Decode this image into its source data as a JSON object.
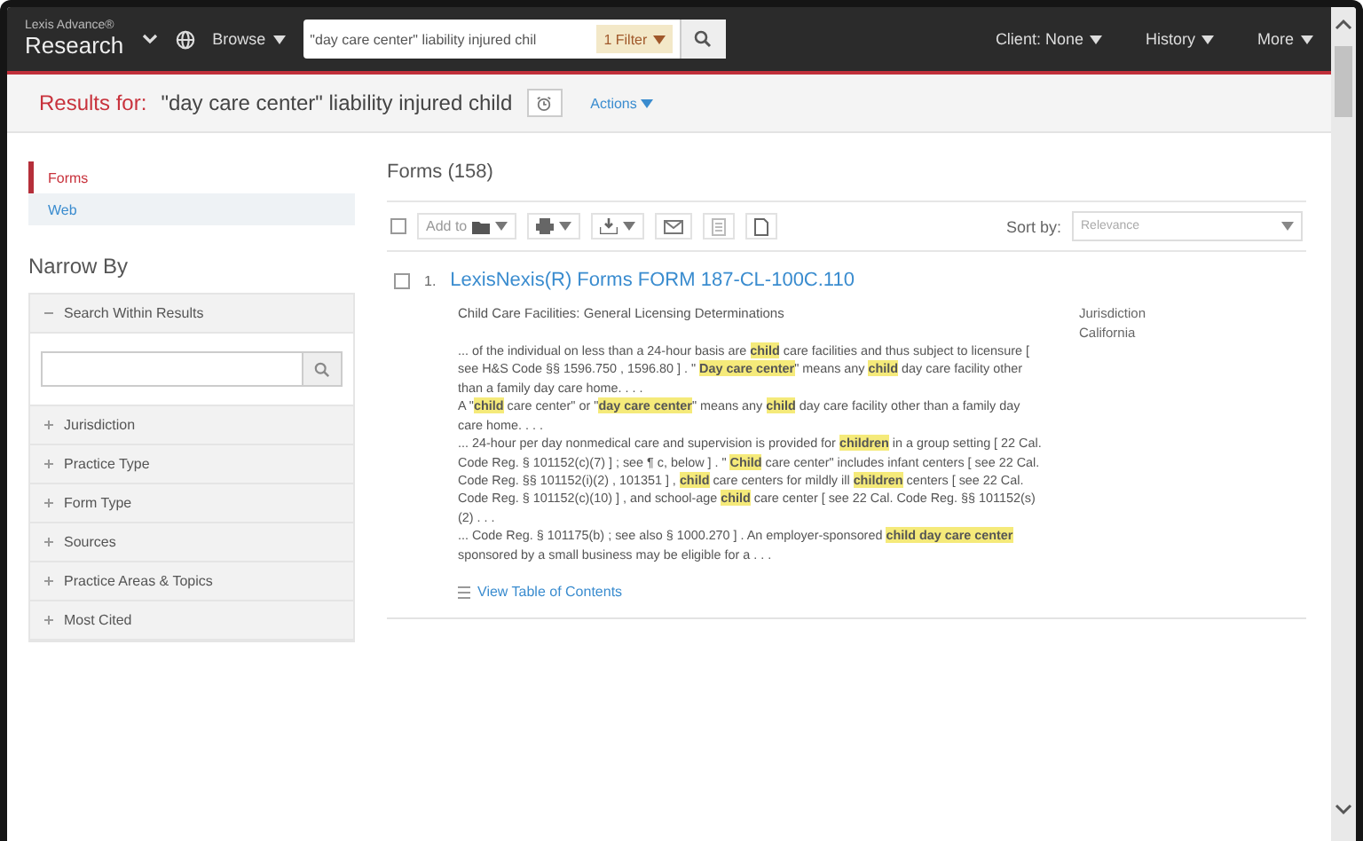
{
  "topbar": {
    "brand_small": "Lexis Advance®",
    "brand": "Research",
    "browse": "Browse",
    "search": {
      "value": "\"day care center\" liability injured chil",
      "filter": "1 Filter"
    },
    "menus": [
      "Client: None",
      "History",
      "More"
    ]
  },
  "results_bar": {
    "label": "Results for:",
    "query": "\"day care center\" liability injured child",
    "actions": "Actions"
  },
  "sidebar": {
    "tabs": [
      {
        "label": "Forms",
        "selected": true
      },
      {
        "label": "Web",
        "selected": false
      }
    ],
    "narrow_by": "Narrow By",
    "filters": [
      {
        "label": "Search Within Results",
        "expanded": true
      },
      {
        "label": "Jurisdiction",
        "expanded": false
      },
      {
        "label": "Practice Type",
        "expanded": false
      },
      {
        "label": "Form Type",
        "expanded": false
      },
      {
        "label": "Sources",
        "expanded": false
      },
      {
        "label": "Practice Areas & Topics",
        "expanded": false
      },
      {
        "label": "Most Cited",
        "expanded": false
      }
    ]
  },
  "main": {
    "heading": "Forms (158)",
    "toolbar": {
      "select_all_checked": false,
      "add_to": "Add to",
      "sort_label": "Sort by:",
      "sort_value": "Relevance"
    },
    "results": [
      {
        "number": "1.",
        "checked": false,
        "title": "LexisNexis(R) Forms FORM 187-CL-100C.110",
        "subtitle": "Child Care Facilities: General Licensing Determinations",
        "meta_label": "Jurisdiction",
        "meta_value": "California",
        "snippets": [
          "... of the individual on less than a 24-hour basis are **child** care facilities and thus subject to licensure [ see H&S Code §§ 1596.750 , 1596.80 ] . \" **Day care center**\" means any **child** day care facility other than a family day care home. . . .",
          "A \"**child** care center\" or \"**day care center**\" means any **child** day care facility other than a family day care home. . . .",
          "... 24-hour per day nonmedical care and supervision is provided for **children** in a group setting [ 22 Cal. Code Reg. § 101152(c)(7) ] ; see ¶ c, below ] . \" **Child** care center\" includes infant centers [ see 22 Cal. Code Reg. §§ 101152(i)(2) , 101351 ] , **child** care centers for mildly ill **children** centers [ see 22 Cal. Code Reg. § 101152(c)(10) ] , and school-age **child** care center [ see 22 Cal. Code Reg. §§ 101152(s)(2) . . .",
          "... Code Reg. § 101175(b) ; see also § 1000.270 ] . An employer-sponsored **child day care center** sponsored by a small business may be eligible for a . . ."
        ],
        "toc_link": "View Table of Contents"
      }
    ]
  }
}
